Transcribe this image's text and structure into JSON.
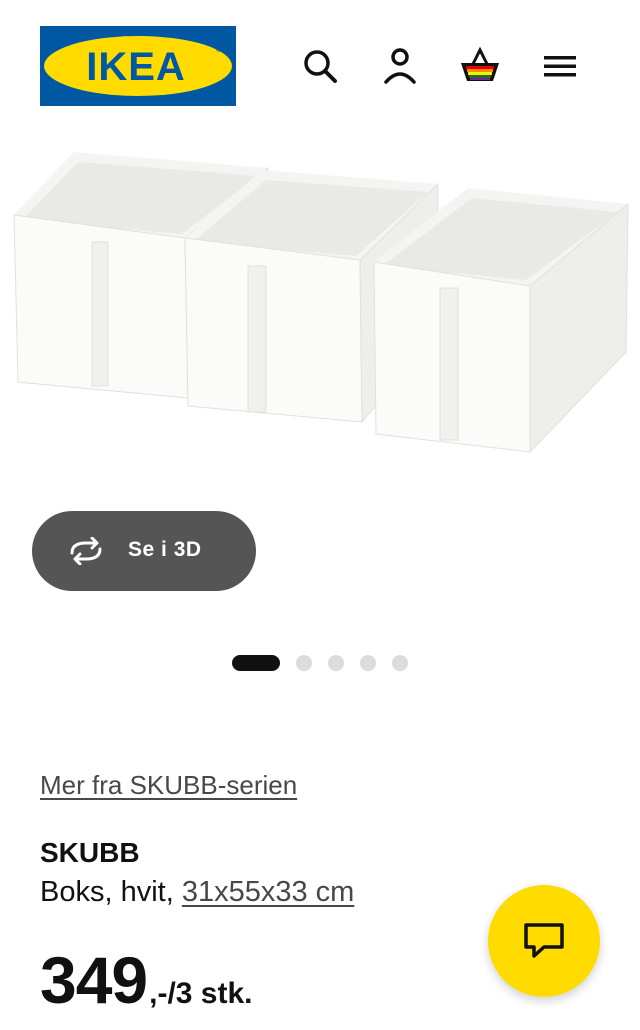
{
  "header": {
    "logo_text": "IKEA",
    "icons": [
      "search-icon",
      "account-icon",
      "shopping-bag-icon",
      "menu-icon"
    ],
    "brand_blue": "#0058a3",
    "brand_yellow": "#ffdb00"
  },
  "gallery": {
    "view_3d_label": "Se i 3D",
    "slide_count": 5,
    "active_slide": 1
  },
  "product": {
    "series_link": "Mer fra SKUBB-serien",
    "name": "SKUBB",
    "desc_prefix": "Boks, hvit, ",
    "measurement": "31x55x33 cm",
    "price_integer": "349",
    "price_suffix": ",-/3 stk."
  },
  "chat": {
    "icon": "chat-icon"
  }
}
